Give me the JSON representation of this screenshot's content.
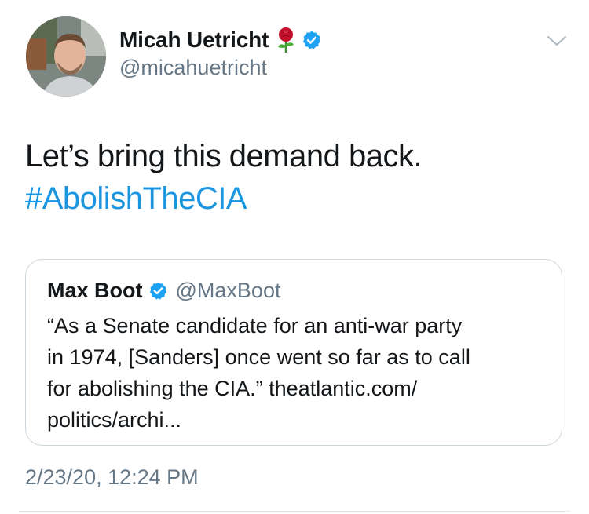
{
  "author": {
    "display_name": "Micah Uetricht",
    "handle": "@micahuetricht",
    "avatar_icon": "profile-photo",
    "name_emoji_icon": "rose-icon",
    "verified": true
  },
  "menu": {
    "icon": "chevron-down-icon"
  },
  "tweet": {
    "text": "Let’s bring this demand back.",
    "hashtag": "#AbolishTheCIA"
  },
  "quoted_tweet": {
    "display_name": "Max Boot",
    "handle": "@MaxBoot",
    "verified": true,
    "lines": [
      "“As a Senate candidate for an anti-war party",
      "in 1974, [Sanders] once went so far as to call",
      "for abolishing the CIA.” theatlantic.com/",
      "politics/archi..."
    ]
  },
  "timestamp": "2/23/20, 12:24 PM",
  "colors": {
    "text": "#14171a",
    "secondary": "#657786",
    "link": "#1b95e0",
    "verified": "#1da1f2",
    "border": "#ccd6dd",
    "rose": "#c8102e"
  }
}
